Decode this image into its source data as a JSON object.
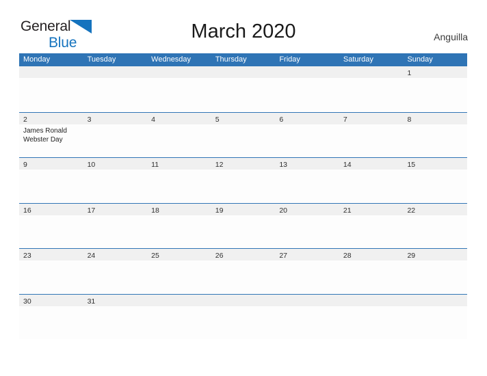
{
  "brand": {
    "name_part1": "General",
    "name_part2": "Blue",
    "flag_icon": "blue-triangle-flag-icon"
  },
  "header": {
    "title": "March 2020",
    "locale": "Anguilla"
  },
  "calendar": {
    "month": "March",
    "year": "2020",
    "weekday_headers": [
      "Monday",
      "Tuesday",
      "Wednesday",
      "Thursday",
      "Friday",
      "Saturday",
      "Sunday"
    ],
    "colors": {
      "header_blue": "#2f74b5",
      "row_rule_blue": "#2f74b5",
      "date_band_gray": "#f0f0f0",
      "brand_blue": "#1573be",
      "text_dark": "#2d2d2d"
    },
    "weeks": [
      [
        {
          "date": "",
          "events": []
        },
        {
          "date": "",
          "events": []
        },
        {
          "date": "",
          "events": []
        },
        {
          "date": "",
          "events": []
        },
        {
          "date": "",
          "events": []
        },
        {
          "date": "",
          "events": []
        },
        {
          "date": "1",
          "events": []
        }
      ],
      [
        {
          "date": "2",
          "events": [
            "James Ronald Webster Day"
          ]
        },
        {
          "date": "3",
          "events": []
        },
        {
          "date": "4",
          "events": []
        },
        {
          "date": "5",
          "events": []
        },
        {
          "date": "6",
          "events": []
        },
        {
          "date": "7",
          "events": []
        },
        {
          "date": "8",
          "events": []
        }
      ],
      [
        {
          "date": "9",
          "events": []
        },
        {
          "date": "10",
          "events": []
        },
        {
          "date": "11",
          "events": []
        },
        {
          "date": "12",
          "events": []
        },
        {
          "date": "13",
          "events": []
        },
        {
          "date": "14",
          "events": []
        },
        {
          "date": "15",
          "events": []
        }
      ],
      [
        {
          "date": "16",
          "events": []
        },
        {
          "date": "17",
          "events": []
        },
        {
          "date": "18",
          "events": []
        },
        {
          "date": "19",
          "events": []
        },
        {
          "date": "20",
          "events": []
        },
        {
          "date": "21",
          "events": []
        },
        {
          "date": "22",
          "events": []
        }
      ],
      [
        {
          "date": "23",
          "events": []
        },
        {
          "date": "24",
          "events": []
        },
        {
          "date": "25",
          "events": []
        },
        {
          "date": "26",
          "events": []
        },
        {
          "date": "27",
          "events": []
        },
        {
          "date": "28",
          "events": []
        },
        {
          "date": "29",
          "events": []
        }
      ],
      [
        {
          "date": "30",
          "events": []
        },
        {
          "date": "31",
          "events": []
        },
        {
          "date": "",
          "events": []
        },
        {
          "date": "",
          "events": []
        },
        {
          "date": "",
          "events": []
        },
        {
          "date": "",
          "events": []
        },
        {
          "date": "",
          "events": []
        }
      ]
    ]
  }
}
